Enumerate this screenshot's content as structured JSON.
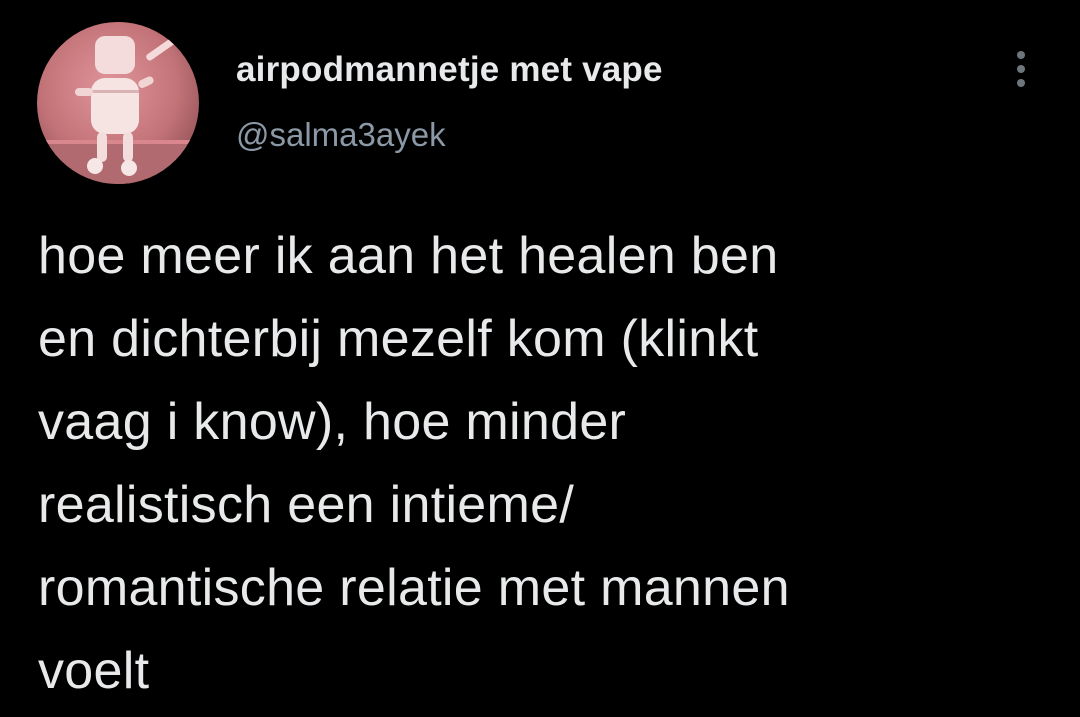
{
  "author": {
    "display_name": "airpodmannetje met vape",
    "handle": "@salma3ayek",
    "avatar_icon": "airpod-robot-avatar-icon"
  },
  "menu": {
    "icon": "more-vertical-icon"
  },
  "tweet": {
    "lines": [
      "hoe meer ik aan het healen ben",
      "en dichterbij mezelf kom (klinkt",
      "vaag i know), hoe minder",
      "realistisch een intieme/",
      "romantische relatie met mannen",
      "voelt"
    ]
  },
  "colors": {
    "background": "#000000",
    "text_primary": "#e7e9ea",
    "text_secondary": "#8b98a5",
    "icon_muted": "#6e767d",
    "avatar_bg": "#c9787c"
  }
}
